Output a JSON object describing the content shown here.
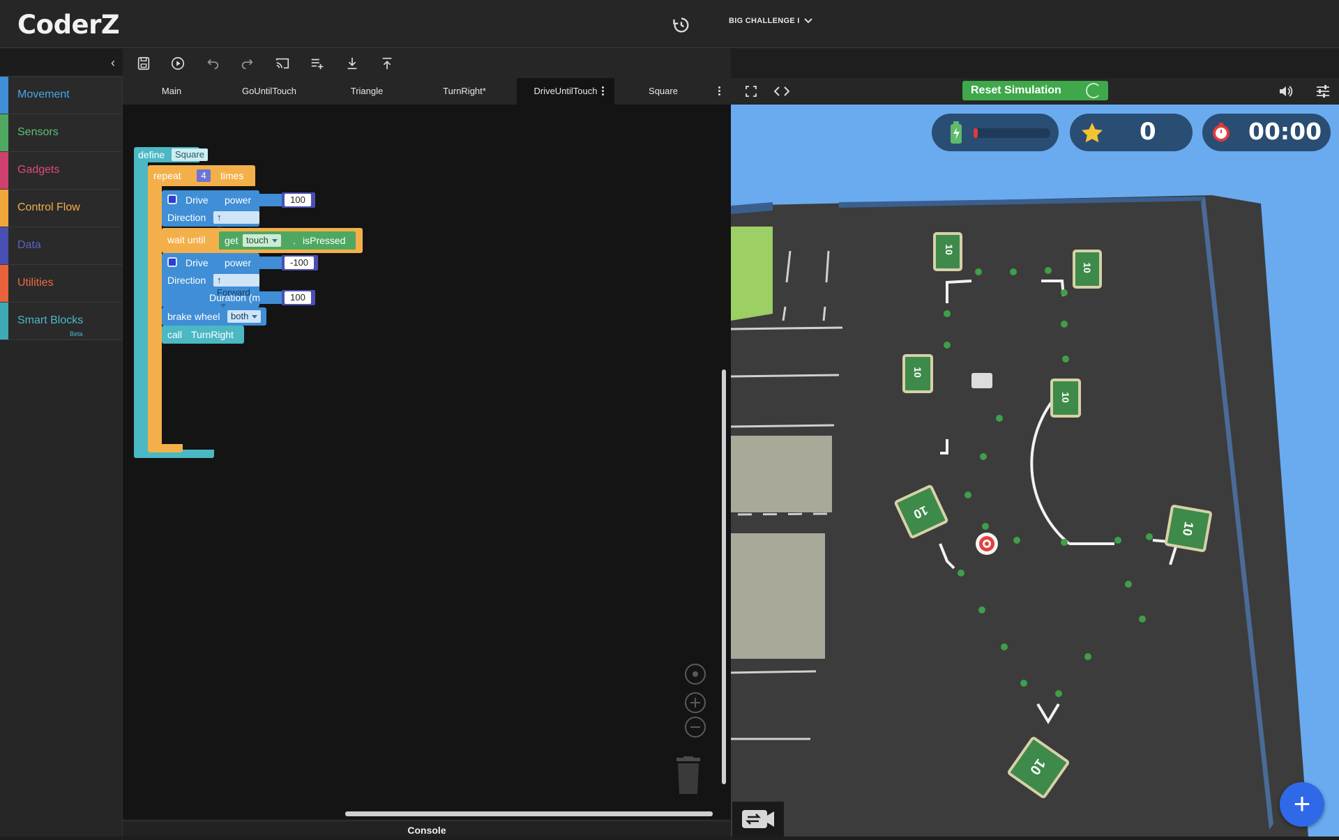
{
  "app": {
    "logo": "CoderZ"
  },
  "header": {
    "challenge_label": "BIG CHALLENGE I"
  },
  "toolbar": {
    "tools": [
      "save-icon",
      "play-icon",
      "undo-icon",
      "redo-icon",
      "cast-icon",
      "add-function-icon",
      "download-icon",
      "upload-icon"
    ]
  },
  "sidebar": {
    "categories": [
      {
        "label": "Movement",
        "color": "#3f8ed6",
        "text_color": "#4aa6e6"
      },
      {
        "label": "Sensors",
        "color": "#4fa862",
        "text_color": "#5fc07a"
      },
      {
        "label": "Gadgets",
        "color": "#d0406e",
        "text_color": "#e04a78"
      },
      {
        "label": "Control Flow",
        "color": "#f0a73a",
        "text_color": "#f3b04a"
      },
      {
        "label": "Data",
        "color": "#4a4fb3",
        "text_color": "#5a64c8"
      },
      {
        "label": "Utilities",
        "color": "#e8623a",
        "text_color": "#ee6b42"
      },
      {
        "label": "Smart Blocks",
        "color": "#3eaab6",
        "text_color": "#4bbac6",
        "badge": "Beta"
      }
    ]
  },
  "tabs": [
    "Main",
    "GoUntilTouch",
    "Triangle",
    "TurnRight*",
    "DriveUntilTouch",
    "Square"
  ],
  "blocks": {
    "define_kw": "define",
    "define_name": "Square",
    "repeat_kw": "repeat",
    "repeat_count": "4",
    "times_kw": "times",
    "drive_kw": "Drive",
    "power_kw": "power",
    "power1": "100",
    "direction_kw": "Direction",
    "direction1": "↑ Forward",
    "wait_kw": "wait until",
    "get_kw": "get",
    "sensor": "touch",
    "dot": ".",
    "prop": "isPressed",
    "power2": "-100",
    "direction2": "↑ Forward",
    "duration_kw": "Duration (ms)",
    "duration": "100",
    "brake_kw": "brake wheel",
    "brake_val": "both",
    "call_kw": "call",
    "call_name": "TurnRight"
  },
  "console": {
    "label": "Console"
  },
  "simulation": {
    "reset_label": "Reset Simulation",
    "battery_level": 0.05,
    "score": "0",
    "timer": "00:00",
    "crate_label": "10"
  }
}
